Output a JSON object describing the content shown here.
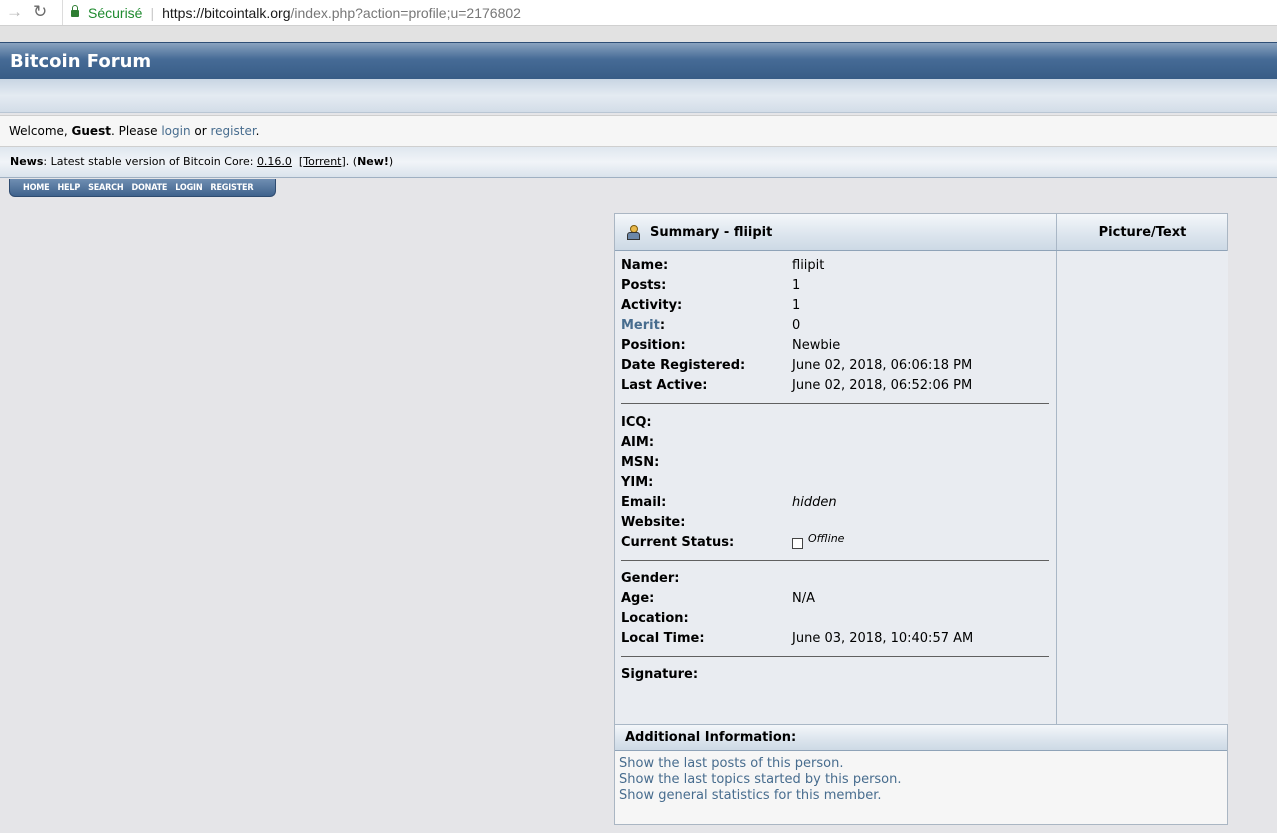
{
  "browser": {
    "secure_label": "Sécurisé",
    "url_host": "https://bitcointalk.org",
    "url_path": "/index.php?action=profile;u=2176802"
  },
  "header": {
    "title": "Bitcoin Forum"
  },
  "welcome": {
    "prefix": "Welcome, ",
    "guest": "Guest",
    "please": ". Please ",
    "login": "login",
    "or": " or ",
    "register": "register",
    "end": "."
  },
  "news": {
    "label": "News",
    "text": ": Latest stable version of Bitcoin Core: ",
    "version": "0.16.0",
    "torrent": "Torrent",
    "new_label": "New!"
  },
  "menu": [
    "HOME",
    "HELP",
    "SEARCH",
    "DONATE",
    "LOGIN",
    "REGISTER"
  ],
  "profile": {
    "summary_title": "Summary - fliipit",
    "picture_title": "Picture/Text",
    "group1": [
      {
        "label": "Name:",
        "value": "fliipit"
      },
      {
        "label": "Posts:",
        "value": "1"
      },
      {
        "label": "Activity:",
        "value": "1"
      },
      {
        "label": "Merit",
        "value": "0"
      },
      {
        "label": "Position:",
        "value": "Newbie"
      },
      {
        "label": "Date Registered:",
        "value": "June 02, 2018, 06:06:18 PM"
      },
      {
        "label": "Last Active:",
        "value": "June 02, 2018, 06:52:06 PM"
      }
    ],
    "group2": [
      {
        "label": "ICQ:",
        "value": ""
      },
      {
        "label": "AIM:",
        "value": ""
      },
      {
        "label": "MSN:",
        "value": ""
      },
      {
        "label": "YIM:",
        "value": ""
      },
      {
        "label": "Email:",
        "value": "hidden"
      },
      {
        "label": "Website:",
        "value": ""
      },
      {
        "label": "Current Status:",
        "value": "Offline"
      }
    ],
    "group3": [
      {
        "label": "Gender:",
        "value": ""
      },
      {
        "label": "Age:",
        "value": "N/A"
      },
      {
        "label": "Location:",
        "value": ""
      },
      {
        "label": "Local Time:",
        "value": "June 03, 2018, 10:40:57 AM"
      }
    ],
    "signature_label": "Signature:",
    "additional_title": "Additional Information:",
    "links": [
      "Show the last posts of this person.",
      "Show the last topics started by this person.",
      "Show general statistics for this member."
    ]
  }
}
